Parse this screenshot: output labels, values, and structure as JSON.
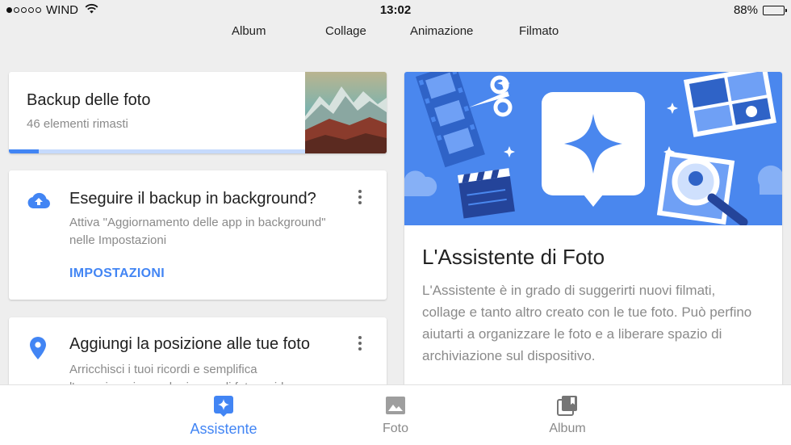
{
  "status_bar": {
    "carrier": "WIND",
    "time": "13:02",
    "battery": "88%",
    "battery_level": 0.88,
    "signal_bars_filled": 1,
    "signal_bars_total": 5
  },
  "top_menu": [
    "Album",
    "Collage",
    "Animazione",
    "Filmato"
  ],
  "backup_card": {
    "title": "Backup delle foto",
    "subtitle": "46 elementi rimasti",
    "progress": 0.1
  },
  "background_card": {
    "title": "Eseguire il backup in background?",
    "body": "Attiva \"Aggiornamento delle app in background\" nelle Impostazioni",
    "action": "IMPOSTAZIONI",
    "icon": "cloud-upload-icon"
  },
  "location_card": {
    "title": "Aggiungi la posizione alle tue foto",
    "body": "Arricchisci i tuoi ricordi e semplifica l'organizzazione e la ricerca di foto e video",
    "icon": "location-pin-icon"
  },
  "assistant_card": {
    "title": "L'Assistente di Foto",
    "body": "L'Assistente è in grado di suggerirti nuovi filmati, collage e tanto altro creato con le tue foto. Può perfino aiutarti a organizzare le foto e a liberare spazio di archiviazione sul dispositivo."
  },
  "bottom_nav": [
    {
      "label": "Assistente",
      "icon": "assistant-icon",
      "active": true
    },
    {
      "label": "Foto",
      "icon": "photo-icon",
      "active": false
    },
    {
      "label": "Album",
      "icon": "album-icon",
      "active": false
    }
  ],
  "colors": {
    "accent": "#4285f4",
    "banner": "#4a87ee",
    "background": "#eeeeee",
    "secondary_text": "#8a8a8a"
  }
}
